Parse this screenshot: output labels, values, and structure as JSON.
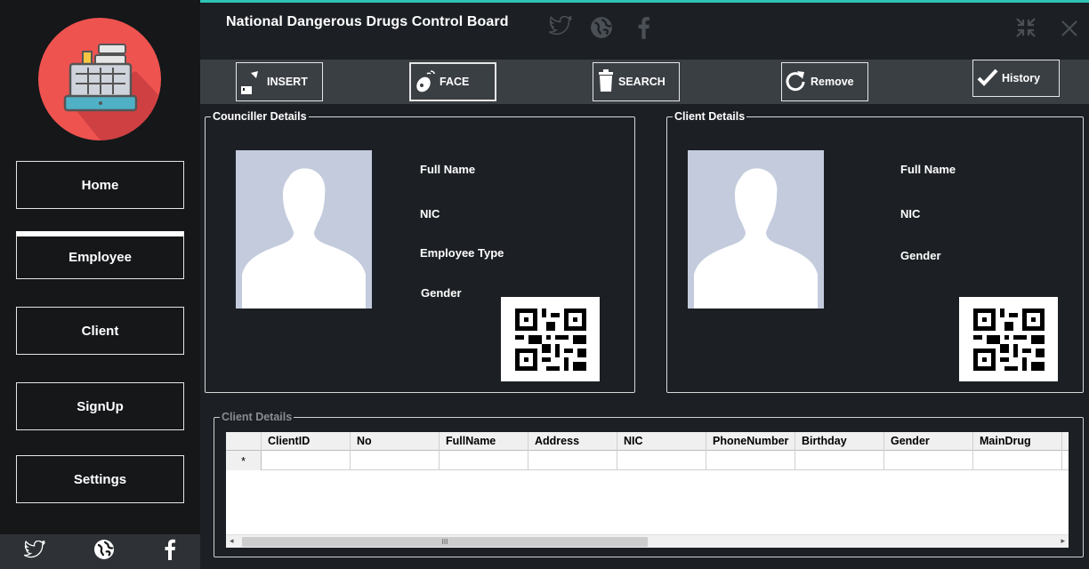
{
  "app": {
    "title": "National Dangerous Drugs Control Board"
  },
  "sidebar": {
    "items": [
      {
        "label": "Home"
      },
      {
        "label": "Employee"
      },
      {
        "label": "Client"
      },
      {
        "label": "SignUp"
      },
      {
        "label": "Settings"
      }
    ],
    "active": "Employee",
    "social_icons": [
      "twitter-icon",
      "globe-icon",
      "facebook-icon"
    ]
  },
  "header": {
    "social_icons": [
      "twitter-icon",
      "globe-icon",
      "facebook-icon"
    ],
    "window_icons": [
      "minimize-arrows-icon",
      "close-icon"
    ]
  },
  "toolbar": {
    "insert_label": "INSERT",
    "face_label": "FACE",
    "search_label": "SEARCH",
    "remove_label": "Remove",
    "history_label": "History"
  },
  "counciller": {
    "title": "Counciller Details",
    "fields": {
      "full_name": "Full Name",
      "nic": "NIC",
      "employee_type": "Employee Type",
      "gender": "Gender"
    }
  },
  "client": {
    "title": "Client Details",
    "fields": {
      "full_name": "Full Name",
      "nic": "NIC",
      "gender": "Gender"
    }
  },
  "client_table": {
    "title": "Client Details",
    "columns": [
      "ClientID",
      "No",
      "FullName",
      "Address",
      "NIC",
      "PhoneNumber",
      "Birthday",
      "Gender",
      "MainDrug"
    ],
    "new_row_marker": "*",
    "scroll_marker": "III"
  },
  "colors": {
    "accent": "#2ec4b6",
    "logo_bg": "#ef5350",
    "background": "#1c2024",
    "sidebar": "#151719",
    "toolbar": "#3a3f44"
  }
}
